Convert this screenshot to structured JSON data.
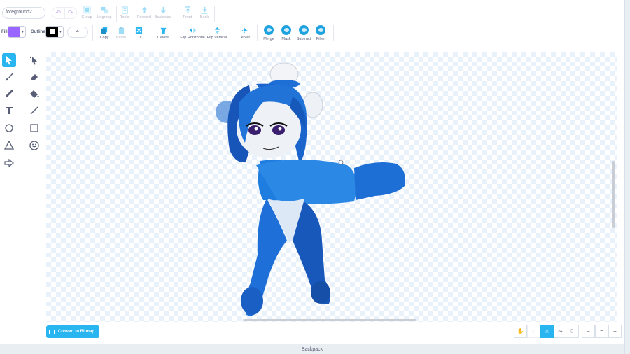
{
  "costume": {
    "name": "foreground2"
  },
  "toolbar": {
    "group": "Group",
    "ungroup": "Ungroup",
    "tools": "Tools",
    "forward": "Forward",
    "backward": "Backward",
    "front": "Front",
    "back": "Back",
    "copy": "Copy",
    "paste": "Paste",
    "cut": "Cut",
    "delete": "Delete",
    "flip_horizontal": "Flip Horizontal",
    "flip_vertical": "Flip Vertical",
    "center": "Center",
    "merge": "Merge",
    "mask": "Mask",
    "subtract": "Subtract",
    "filter": "Filter"
  },
  "style": {
    "fill_label": "Fill",
    "fill_color": "#9966ff",
    "outline_label": "Outline",
    "outline_color": "#000000",
    "outline_width": "4"
  },
  "tools": [
    "select-tool",
    "reshape-tool",
    "brush-tool",
    "eraser-tool",
    "pen-tool",
    "fill-tool",
    "text-tool",
    "line-tool",
    "circle-tool",
    "rectangle-tool",
    "triangle-tool",
    "emoji-tool",
    "arrow-tool"
  ],
  "convert_label": "Convert to Bitmap",
  "zoom": {
    "out": "−",
    "reset": "=",
    "in": "+"
  },
  "backpack_label": "Backpack",
  "colors": {
    "accent": "#29b5ef",
    "sprite_blue": "#1d6fd6"
  }
}
